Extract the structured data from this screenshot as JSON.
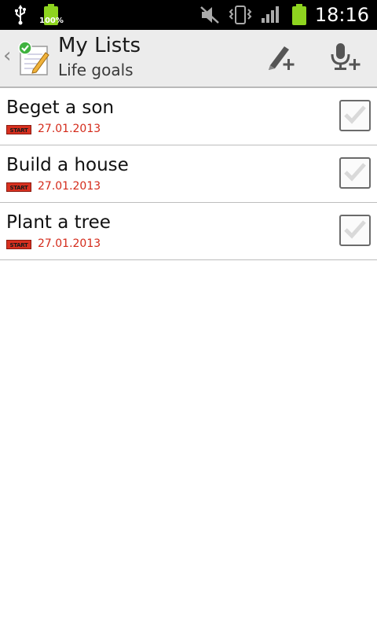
{
  "status_bar": {
    "time": "18:16",
    "battery_small_label": "100%",
    "icons": [
      "usb-icon",
      "battery-full-icon",
      "muted-icon",
      "vibrate-icon",
      "signal-icon",
      "battery-icon"
    ]
  },
  "action_bar": {
    "title": "My Lists",
    "subtitle": "Life goals",
    "icons": [
      "back-chevron-icon",
      "notepad-icon",
      "add-item-pencil-icon",
      "add-voice-item-icon"
    ]
  },
  "list": {
    "badge_label": "START",
    "items": [
      {
        "title": "Beget a son",
        "date": "27.01.2013"
      },
      {
        "title": "Build a house",
        "date": "27.01.2013"
      },
      {
        "title": "Plant a tree",
        "date": "27.01.2013"
      }
    ]
  },
  "colors": {
    "status_bar_bg": "#000000",
    "action_bar_bg": "#ececec",
    "date_red": "#d42a1a",
    "badge_red": "#d8301f",
    "battery_green": "#8ed41f"
  }
}
